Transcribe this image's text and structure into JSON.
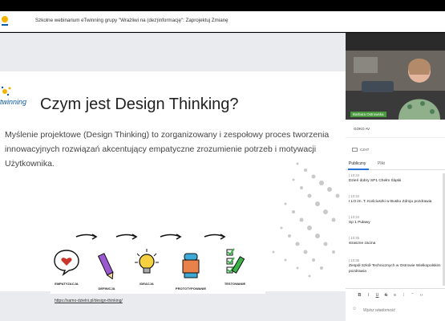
{
  "app": {
    "title": "Szkolne webinarium eTwinning grupy \"Wrażliwi na (dez)informację\": Zaprojektuj Zmianę"
  },
  "slide": {
    "logo_text": "twinning",
    "title": "Czym jest Design Thinking?",
    "body": "Myślenie projektowe (Design Thinking) to zorganizowany i zespołowy proces tworzenia innowacyjnych rozwiązań akcentujący empatyczne zrozumienie potrzeb i motywacji Użytkownika.",
    "steps": [
      "EMPATYZACJA",
      "DEFINICJA",
      "IDEACJA",
      "PROTOTYPOWANIE",
      "TESTOWANIE"
    ],
    "source_link": "https://samo-dzielni.pl/design-thinking/"
  },
  "video": {
    "participant_name": "Barbara Ostrowska",
    "user_label": "GOKO AV"
  },
  "chat": {
    "title": "CZAT",
    "tabs": [
      "Publiczny",
      "Pliki"
    ],
    "messages": [
      {
        "time": "| 10:34",
        "text": "Dzień dobry SP1 Chełm Śląski"
      },
      {
        "time": "| 10:34",
        "text": "I LO im. T. Kościuszki w Busku Zdroju pozdrawia"
      },
      {
        "time": "| 10:34",
        "text": "Sp 1 Puławy"
      },
      {
        "time": "| 10:35",
        "text": "straszne zacina"
      },
      {
        "time": "| 10:35",
        "text": "Zespół Szkół Technicznych w Ostrowie Wielkopolskim pozdrawia"
      }
    ],
    "format_buttons": [
      "B",
      "I",
      "U",
      "S",
      "≡",
      "⁝",
      "“",
      "‹›"
    ],
    "input_placeholder": "Wpisz wiadomość"
  },
  "colors": {
    "accent": "#2a6fdb",
    "name_tag": "#4a9a3e"
  }
}
